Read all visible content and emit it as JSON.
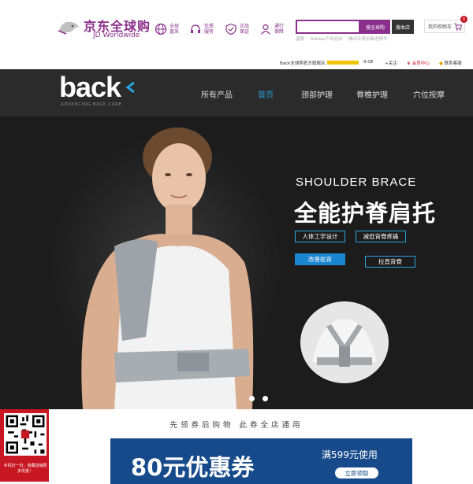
{
  "header": {
    "logo_cn": "京东全球购",
    "logo_en": "JD Worldwide",
    "services": [
      {
        "icon": "globe-icon",
        "label": "全球 直采"
      },
      {
        "icon": "headset-icon",
        "label": "优质 服务"
      },
      {
        "icon": "shield-icon",
        "label": "正品 保证"
      },
      {
        "icon": "user-icon",
        "label": "通行 保障"
      }
    ],
    "search": {
      "placeholder": "",
      "search_all_label": "搜全球购",
      "search_shop_label": "搜本店",
      "hot_words": [
        "温泉",
        "Adidas平去运动",
        "雅诗兰黛抗衰老精华"
      ]
    },
    "cart": {
      "label": "我的购物车",
      "count": "0"
    }
  },
  "shop_bar": {
    "shop_name": "Back全球购官方旗舰店",
    "score": "9.08",
    "follow_label": "+关注",
    "member_label": "会员中心",
    "service_label": "联系客服",
    "rating_fraction": 0.9
  },
  "nav": {
    "brand": "back",
    "brand_tagline": "ADVANCING BACK CARE",
    "items": [
      "所有产品",
      "首页",
      "颈部护理",
      "脊椎护理",
      "穴位按摩"
    ],
    "active_index": 1
  },
  "banner": {
    "subtitle": "SHOULDER BRACE",
    "title": "全能护脊肩托",
    "tags": [
      "人体工学设计",
      "减低背脊疼痛",
      "改善驼背",
      "拉直背脊"
    ],
    "slide_count": 2
  },
  "qr": {
    "caption": "手机扫一扫，收藏店铺更多优惠！"
  },
  "coupon": {
    "headline": "先领券后购物 此券全店通用",
    "amount": "80元优惠券",
    "condition": "满599元使用",
    "button": "立即领取"
  },
  "colors": {
    "brand_purple": "#8b2f8c",
    "nav_active": "#29a3e0",
    "coupon_blue": "#174a8b",
    "jd_red": "#c81623"
  }
}
